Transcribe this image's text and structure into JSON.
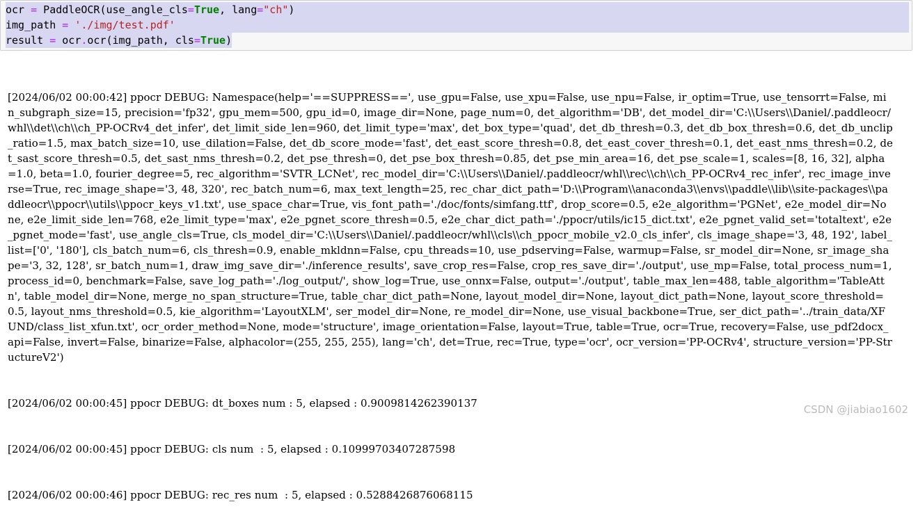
{
  "code_cell": {
    "line1": {
      "a": "ocr ",
      "b": "=",
      "c": " PaddleOCR(use_angle_cls",
      "d": "=",
      "e": "True",
      "f": ", lang",
      "g": "=",
      "h": "\"ch\"",
      "i": ")"
    },
    "line2": {
      "a": "img_path ",
      "b": "=",
      "c": " ",
      "d": "'./img/test.pdf'"
    },
    "line3": {
      "a": "result ",
      "b": "=",
      "c": " ocr",
      "d": ".",
      "e": "ocr(img_path, cls",
      "f": "=",
      "g": "True",
      "h": ")"
    }
  },
  "output": {
    "namespace_log": "[2024/06/02 00:00:42] ppocr DEBUG: Namespace(help='==SUPPRESS==', use_gpu=False, use_xpu=False, use_npu=False, ir_optim=True, use_tensorrt=False, min_subgraph_size=15, precision='fp32', gpu_mem=500, gpu_id=0, image_dir=None, page_num=0, det_algorithm='DB', det_model_dir='C:\\\\Users\\\\Daniel/.paddleocr/whl\\\\det\\\\ch\\\\ch_PP-OCRv4_det_infer', det_limit_side_len=960, det_limit_type='max', det_box_type='quad', det_db_thresh=0.3, det_db_box_thresh=0.6, det_db_unclip_ratio=1.5, max_batch_size=10, use_dilation=False, det_db_score_mode='fast', det_east_score_thresh=0.8, det_east_cover_thresh=0.1, det_east_nms_thresh=0.2, det_sast_score_thresh=0.5, det_sast_nms_thresh=0.2, det_pse_thresh=0, det_pse_box_thresh=0.85, det_pse_min_area=16, det_pse_scale=1, scales=[8, 16, 32], alpha=1.0, beta=1.0, fourier_degree=5, rec_algorithm='SVTR_LCNet', rec_model_dir='C:\\\\Users\\\\Daniel/.paddleocr/whl\\\\rec\\\\ch\\\\ch_PP-OCRv4_rec_infer', rec_image_inverse=True, rec_image_shape='3, 48, 320', rec_batch_num=6, max_text_length=25, rec_char_dict_path='D:\\\\Program\\\\anaconda3\\\\envs\\\\paddle\\\\lib\\\\site-packages\\\\paddleocr\\\\ppocr\\\\utils\\\\ppocr_keys_v1.txt', use_space_char=True, vis_font_path='./doc/fonts/simfang.ttf', drop_score=0.5, e2e_algorithm='PGNet', e2e_model_dir=None, e2e_limit_side_len=768, e2e_limit_type='max', e2e_pgnet_score_thresh=0.5, e2e_char_dict_path='./ppocr/utils/ic15_dict.txt', e2e_pgnet_valid_set='totaltext', e2e_pgnet_mode='fast', use_angle_cls=True, cls_model_dir='C:\\\\Users\\\\Daniel/.paddleocr/whl\\\\cls\\\\ch_ppocr_mobile_v2.0_cls_infer', cls_image_shape='3, 48, 192', label_list=['0', '180'], cls_batch_num=6, cls_thresh=0.9, enable_mkldnn=False, cpu_threads=10, use_pdserving=False, warmup=False, sr_model_dir=None, sr_image_shape='3, 32, 128', sr_batch_num=1, draw_img_save_dir='./inference_results', save_crop_res=False, crop_res_save_dir='./output', use_mp=False, total_process_num=1, process_id=0, benchmark=False, save_log_path='./log_output/', show_log=True, use_onnx=False, output='./output', table_max_len=488, table_algorithm='TableAttn', table_model_dir=None, merge_no_span_structure=True, table_char_dict_path=None, layout_model_dir=None, layout_dict_path=None, layout_score_threshold=0.5, layout_nms_threshold=0.5, kie_algorithm='LayoutXLM', ser_model_dir=None, re_model_dir=None, use_visual_backbone=True, ser_dict_path='../train_data/XFUND/class_list_xfun.txt', ocr_order_method=None, mode='structure', image_orientation=False, layout=True, table=True, ocr=True, recovery=False, use_pdf2docx_api=False, invert=False, binarize=False, alphacolor=(255, 255, 255), lang='ch', det=True, rec=True, type='ocr', ocr_version='PP-OCRv4', structure_version='PP-StructureV2')",
    "dt_boxes_log": "[2024/06/02 00:00:45] ppocr DEBUG: dt_boxes num : 5, elapsed : 0.9009814262390137",
    "cls_log": "[2024/06/02 00:00:45] ppocr DEBUG: cls num  : 5, elapsed : 0.10999703407287598",
    "rec_log": "[2024/06/02 00:00:46] ppocr DEBUG: rec_res num  : 5, elapsed : 0.5288426876068115"
  },
  "watermark": "CSDN @jiabiao1602",
  "colors": {
    "selection": "#d7d7f2",
    "keyword": "#008000",
    "operator": "#aa22ff",
    "string": "#ba2121"
  }
}
